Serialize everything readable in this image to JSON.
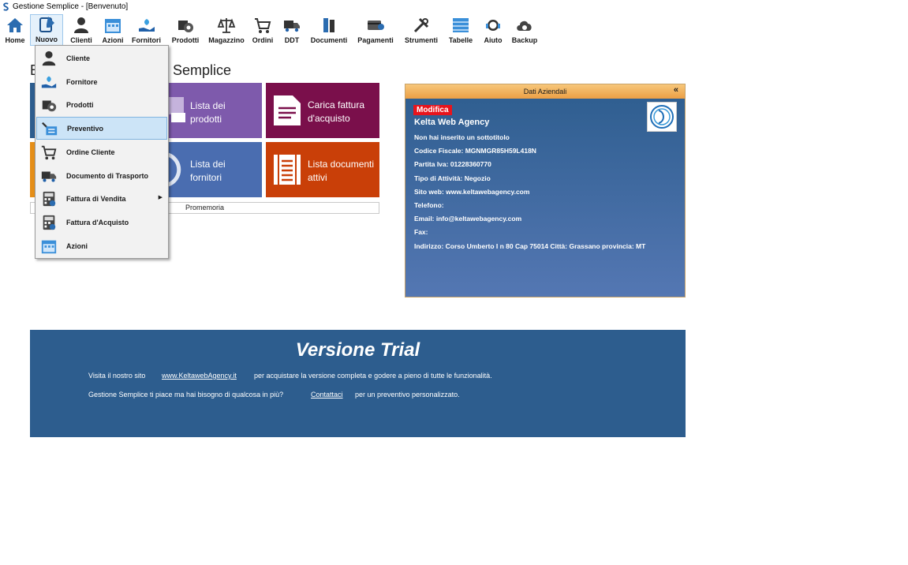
{
  "window": {
    "title": "Gestione Semplice - [Benvenuto]"
  },
  "toolbar": {
    "items": [
      {
        "label": "Home",
        "icon": "home-icon"
      },
      {
        "label": "Nuovo",
        "icon": "new-document-icon"
      },
      {
        "label": "Clienti",
        "icon": "user-icon"
      },
      {
        "label": "Azioni",
        "icon": "calendar-icon"
      },
      {
        "label": "Fornitori",
        "icon": "hand-plant-icon"
      },
      {
        "label": "Prodotti",
        "icon": "gear-box-icon"
      },
      {
        "label": "Magazzino",
        "icon": "scale-icon"
      },
      {
        "label": "Ordini",
        "icon": "cart-icon"
      },
      {
        "label": "DDT",
        "icon": "truck-icon"
      },
      {
        "label": "Documenti",
        "icon": "binders-icon"
      },
      {
        "label": "Pagamenti",
        "icon": "payment-card-icon"
      },
      {
        "label": "Strumenti",
        "icon": "tools-icon"
      },
      {
        "label": "Tabelle",
        "icon": "table-icon"
      },
      {
        "label": "Aiuto",
        "icon": "support-headset-icon"
      },
      {
        "label": "Backup",
        "icon": "cloud-backup-icon"
      }
    ]
  },
  "main": {
    "heading_prefix": "B",
    "heading_suffix": "e Semplice",
    "tiles": {
      "lista_prodotti": "Lista dei prodotti",
      "carica_fattura": "Carica fattura d'acquisto",
      "lista_fornitori": "Lista dei fornitori",
      "lista_documenti": "Lista documenti attivi"
    },
    "promemoria": "Promemoria"
  },
  "company": {
    "header": "Dati Aziendali",
    "collapse": "«",
    "edit_label": "Modifica",
    "name": "Kelta Web Agency",
    "lines": [
      "Non hai inserito un sottotitolo",
      "Codice Fiscale: MGNMGR85H59L418N",
      "Partita Iva: 01228360770",
      "Tipo di Attività: Negozio",
      "Sito web: www.keltawebagency.com",
      "Telefono:",
      "Email: info@keltawebagency.com",
      "Fax:",
      "Indirizzo: Corso Umberto I n 80 Cap 75014 Città: Grassano provincia: MT"
    ]
  },
  "trial": {
    "title": "Versione Trial",
    "line1_a": "Visita il nostro sito",
    "line1_link": "www.KeltawebAgency.it",
    "line1_b": "per acquistare la versione completa e godere a pieno di tutte le funzionalità.",
    "line2_a": "Gestione Semplice ti piace ma hai bisogno di qualcosa in più?",
    "line2_link": "Contattaci",
    "line2_b": "per un preventivo personalizzato."
  },
  "menu": {
    "items": [
      {
        "label": "Cliente",
        "icon": "user-icon"
      },
      {
        "label": "Fornitore",
        "icon": "hand-plant-icon"
      },
      {
        "label": "Prodotti",
        "icon": "gear-box-icon"
      },
      {
        "label": "Preventivo",
        "icon": "quote-icon"
      },
      {
        "label": "Ordine Cliente",
        "icon": "cart-icon"
      },
      {
        "label": "Documento di Trasporto",
        "icon": "truck-icon"
      },
      {
        "label": "Fattura di Vendita",
        "icon": "calculator-icon",
        "submenu_arrow": "▶"
      },
      {
        "label": "Fattura d'Acquisto",
        "icon": "calculator-icon"
      },
      {
        "label": "Azioni",
        "icon": "calendar-icon"
      }
    ],
    "hovered": "Preventivo"
  },
  "colors": {
    "tile_purple": "#7e5aac",
    "tile_maroon": "#7a0f4b",
    "tile_blue": "#4a6db0",
    "tile_orange": "#c93f08",
    "panel_blue": "#2d5d8e",
    "accent_red": "#e8141c"
  }
}
